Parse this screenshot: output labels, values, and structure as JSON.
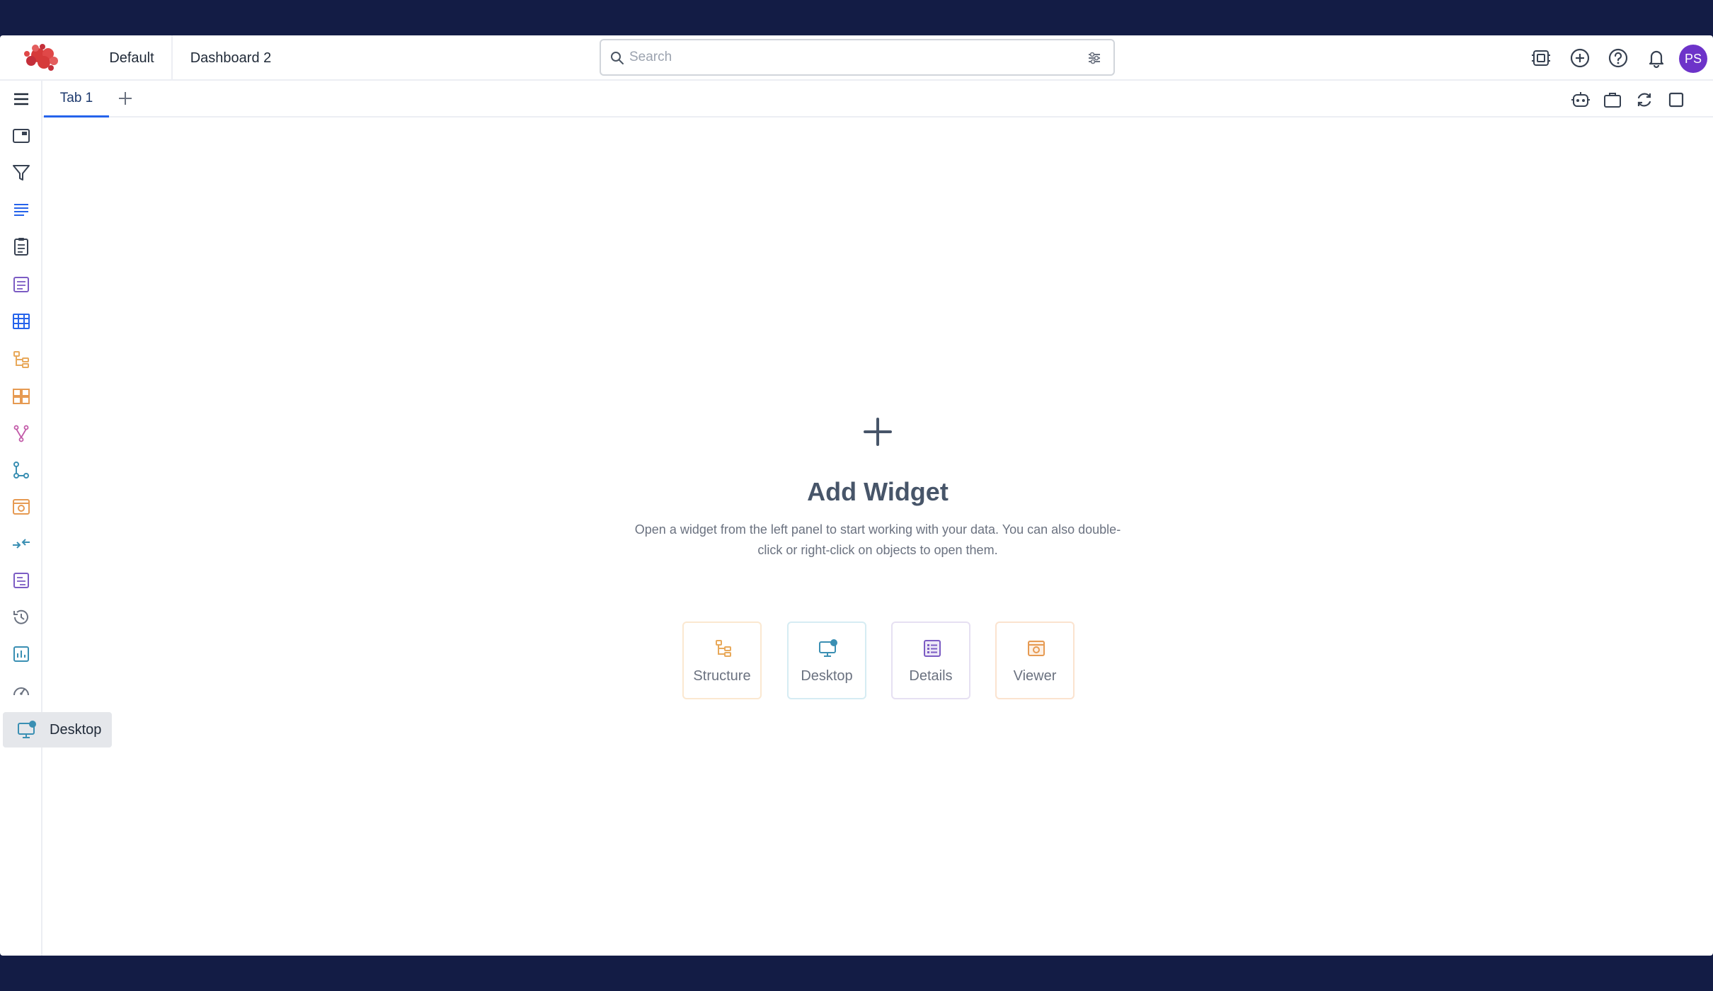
{
  "header": {
    "tabs": [
      {
        "label": "Default"
      },
      {
        "label": "Dashboard 2"
      }
    ],
    "search": {
      "placeholder": "Search",
      "value": ""
    },
    "avatar_initials": "PS"
  },
  "tabs": [
    {
      "label": "Tab 1",
      "active": true
    }
  ],
  "empty_state": {
    "title": "Add Widget",
    "description": "Open a widget from the left panel to start working with your data. You can also double-click or right-click on objects to open them.",
    "widgets": [
      {
        "label": "Structure",
        "icon": "structure-icon",
        "color": "#e8a95b"
      },
      {
        "label": "Desktop",
        "icon": "desktop-icon",
        "color": "#3a8fb3"
      },
      {
        "label": "Details",
        "icon": "details-icon",
        "color": "#7c5cc4"
      },
      {
        "label": "Viewer",
        "icon": "viewer-icon",
        "color": "#e69a52"
      }
    ]
  },
  "sidebar": {
    "tooltip": "Desktop",
    "items": [
      "menu-icon",
      "window-icon",
      "filter-icon",
      "list-icon",
      "clipboard-icon",
      "form-icon",
      "table-icon",
      "structure-icon",
      "grid-icon",
      "branch-icon",
      "flow-icon",
      "viewer-icon",
      "arrows-in-icon",
      "report-icon",
      "history-icon",
      "chart-icon",
      "gauge-icon",
      "desktop-icon"
    ]
  },
  "colors": {
    "frame": "#131c45",
    "accent": "#2563eb",
    "avatar": "#6d33c9",
    "logo": "#d63a3a"
  }
}
